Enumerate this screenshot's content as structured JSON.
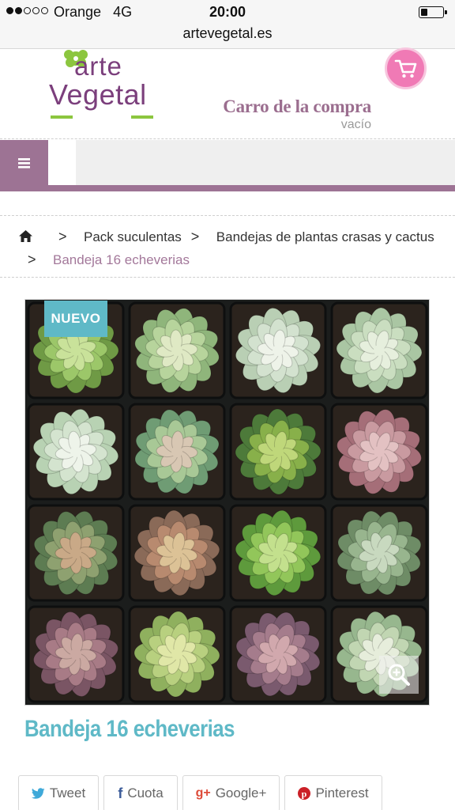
{
  "status_bar": {
    "carrier": "Orange",
    "network": "4G",
    "time": "20:00",
    "url": "artevegetal.es",
    "signal_bars_filled": 2,
    "signal_bars_total": 5,
    "battery_level": 0.3
  },
  "header": {
    "logo_line1": "arte",
    "logo_line2": "Vegetal",
    "cart_title": "Carro de la compra",
    "cart_status": "vacío",
    "cart_icon": "shopping-cart-icon",
    "brand_color": "#9d7394",
    "cart_color": "#f07ab5"
  },
  "menu": {
    "icon": "hamburger-icon"
  },
  "breadcrumb": {
    "home_icon": "home-icon",
    "items": [
      "Pack suculentas",
      "Bandejas de plantas crasas y cactus"
    ],
    "current": "Bandeja 16 echeverias"
  },
  "product": {
    "badge": "NUEVO",
    "title": "Bandeja 16 echeverias",
    "zoom_icon": "zoom-in-icon",
    "accent_color": "#5fb9c7"
  },
  "share": {
    "buttons": [
      {
        "icon": "twitter-icon",
        "label": "Tweet"
      },
      {
        "icon": "facebook-icon",
        "label": "Cuota"
      },
      {
        "icon": "google-plus-icon",
        "label": "Google+"
      },
      {
        "icon": "pinterest-icon",
        "label": "Pinterest"
      }
    ]
  }
}
